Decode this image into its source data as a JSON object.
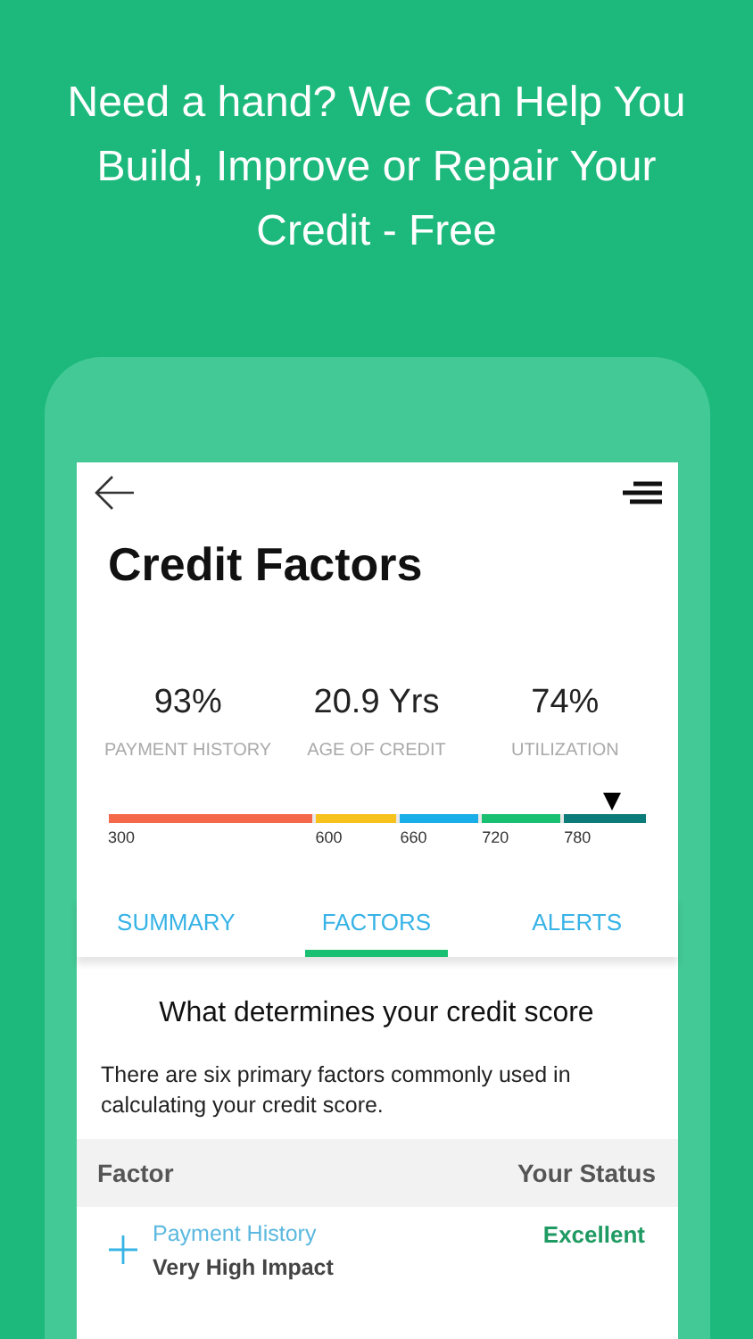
{
  "headline": "Need a hand? We Can Help You Build, Improve or Repair Your Credit - Free",
  "screen": {
    "title": "Credit Factors",
    "stats": [
      {
        "value": "93%",
        "label": "PAYMENT HISTORY"
      },
      {
        "value": "20.9 Yrs",
        "label": "AGE OF CREDIT"
      },
      {
        "value": "74%",
        "label": "UTILIZATION"
      }
    ],
    "score_bar": {
      "level": 0.94,
      "segments": [
        {
          "label": "300",
          "color": "#f4694a"
        },
        {
          "label": "600",
          "color": "#f7c21b"
        },
        {
          "label": "660",
          "color": "#1aaee8"
        },
        {
          "label": "720",
          "color": "#19c072"
        },
        {
          "label": "780",
          "color": "#0b7c79"
        }
      ]
    },
    "tabs": [
      {
        "label": "SUMMARY",
        "selected": false
      },
      {
        "label": "FACTORS",
        "selected": true
      },
      {
        "label": "ALERTS",
        "selected": false
      }
    ],
    "section_heading": "What determines your credit score",
    "intro": "There are six primary factors commonly used in calculating your credit score.",
    "table": {
      "columns": [
        "Factor",
        "Your Status"
      ],
      "rows": [
        {
          "factor": "Payment History",
          "impact": "Very High Impact",
          "status": "Excellent",
          "expanded": false
        }
      ]
    }
  }
}
